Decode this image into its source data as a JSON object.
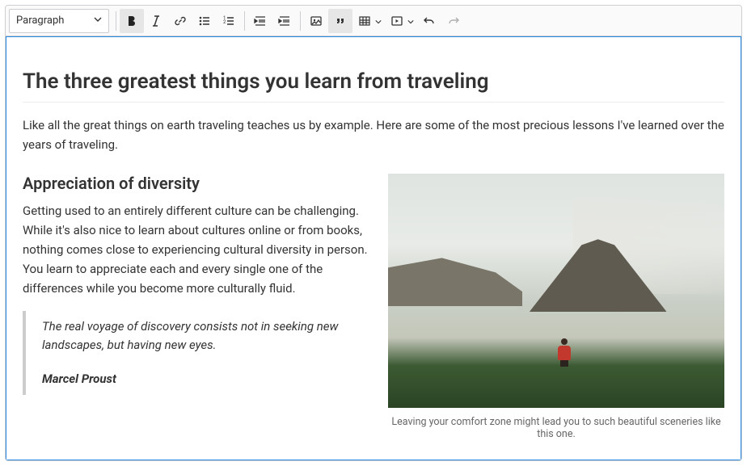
{
  "toolbar": {
    "heading_dropdown": "Paragraph"
  },
  "doc": {
    "title": "The three greatest things you learn from traveling",
    "intro": "Like all the great things on earth traveling teaches us by example. Here are some of the most precious lessons I've learned over the years of traveling.",
    "section1": {
      "heading": "Appreciation of diversity",
      "body": "Getting used to an entirely different culture can be challenging. While it's also nice to learn about cultures online or from books, nothing comes close to experiencing cultural diversity in person. You learn to appreciate each and every single one of the differences while you become more culturally fluid.",
      "quote_text": "The real voyage of discovery consists not in seeking new landscapes, but having new eyes.",
      "quote_author": "Marcel Proust"
    },
    "figure": {
      "caption": "Leaving your comfort zone might lead you to such beautiful sceneries like this one."
    }
  }
}
